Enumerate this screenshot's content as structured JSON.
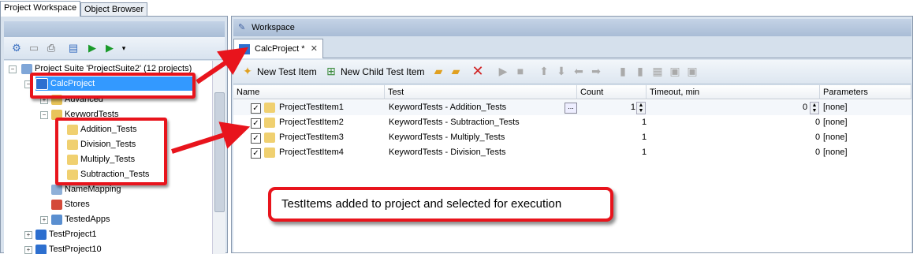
{
  "tabs": {
    "project_workspace": "Project Workspace",
    "object_browser": "Object Browser"
  },
  "tree": {
    "suite": "Project Suite 'ProjectSuite2' (12 projects)",
    "calc": "CalcProject",
    "advanced": "Advanced",
    "keyword_tests": "KeywordTests",
    "tests": [
      "Addition_Tests",
      "Division_Tests",
      "Multiply_Tests",
      "Subtraction_Tests"
    ],
    "namemapping": "NameMapping",
    "stores": "Stores",
    "testedapps": "TestedApps",
    "p1": "TestProject1",
    "p10": "TestProject10"
  },
  "workspace": {
    "title": "Workspace",
    "tab": "CalcProject *",
    "close": "✕"
  },
  "toolbar": {
    "new_item": "New Test Item",
    "new_child": "New Child Test Item"
  },
  "grid": {
    "headers": {
      "name": "Name",
      "test": "Test",
      "count": "Count",
      "timeout": "Timeout, min",
      "params": "Parameters"
    },
    "rows": [
      {
        "name": "ProjectTestItem1",
        "test": "KeywordTests - Addition_Tests",
        "count": "1",
        "timeout": "0",
        "params": "[none]"
      },
      {
        "name": "ProjectTestItem2",
        "test": "KeywordTests - Subtraction_Tests",
        "count": "1",
        "timeout": "0",
        "params": "[none]"
      },
      {
        "name": "ProjectTestItem3",
        "test": "KeywordTests - Multiply_Tests",
        "count": "1",
        "timeout": "0",
        "params": "[none]"
      },
      {
        "name": "ProjectTestItem4",
        "test": "KeywordTests - Division_Tests",
        "count": "1",
        "timeout": "0",
        "params": "[none]"
      }
    ],
    "ellipsis": "..."
  },
  "callout": "TestItems added to project and selected for execution",
  "colors": {
    "annotation_red": "#e8141c",
    "selection_blue": "#3399ff"
  }
}
